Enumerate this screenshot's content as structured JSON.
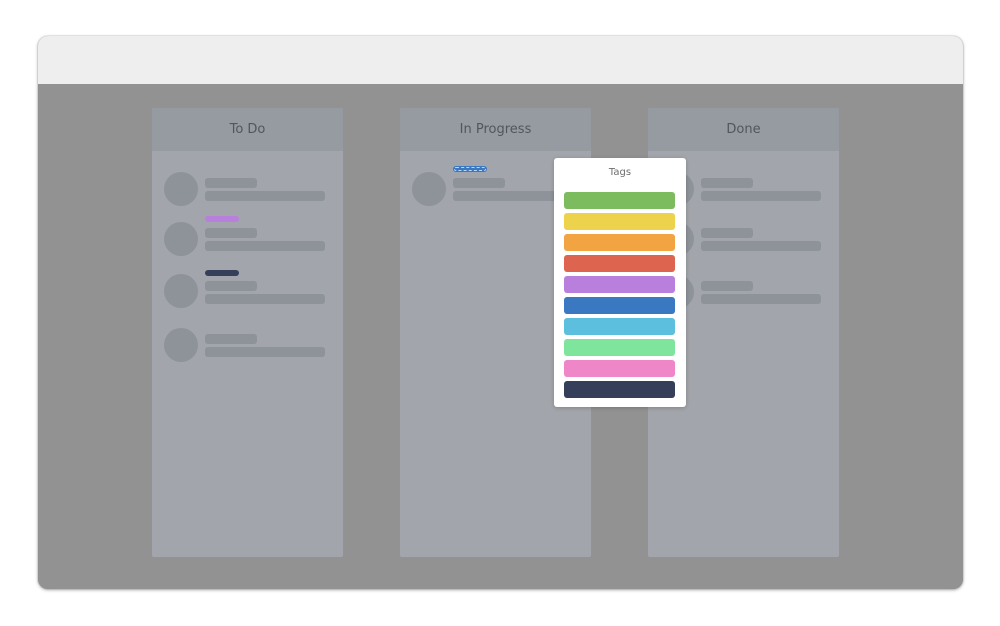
{
  "board": {
    "columns": [
      {
        "title": "To Do"
      },
      {
        "title": "In Progress"
      },
      {
        "title": "Done"
      }
    ]
  },
  "popover": {
    "title": "Tags",
    "tags": [
      {
        "color": "#7dbb5f"
      },
      {
        "color": "#ecd34b"
      },
      {
        "color": "#f2a443"
      },
      {
        "color": "#dd644f"
      },
      {
        "color": "#b97fdc"
      },
      {
        "color": "#3a78c2"
      },
      {
        "color": "#5bbfdd"
      },
      {
        "color": "#7fe59c"
      },
      {
        "color": "#ee86c8"
      },
      {
        "color": "#353f59"
      }
    ]
  },
  "card_tags": {
    "todo_card_2": "#b97fdc",
    "todo_card_3": "#353f59",
    "progress_card_1": "#3a78c2"
  }
}
